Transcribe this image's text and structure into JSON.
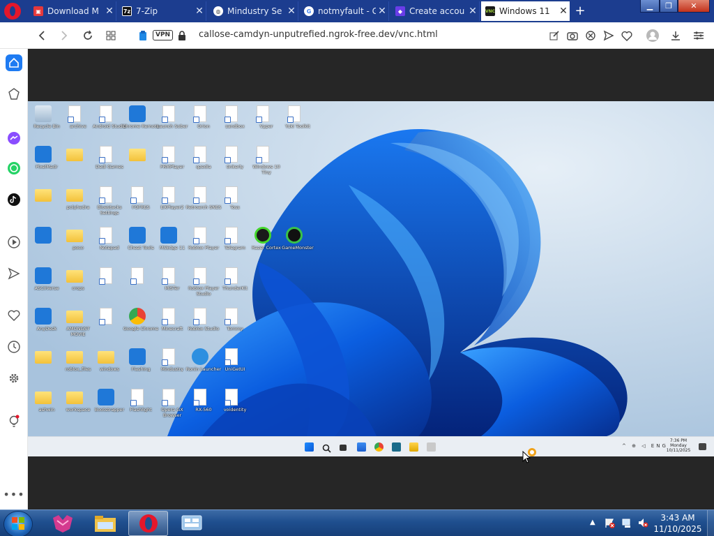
{
  "browser": {
    "tabs": [
      {
        "label": "Download M",
        "favicon": "download-icon",
        "color": "#e5383b"
      },
      {
        "label": "7-Zip",
        "favicon": "7zip-icon",
        "color": "#111111"
      },
      {
        "label": "Mindustry Se",
        "favicon": "globe-icon",
        "color": "#555555"
      },
      {
        "label": "notmyfault - G",
        "favicon": "google-icon",
        "color": "#4285f4"
      },
      {
        "label": "Create accou",
        "favicon": "app-icon",
        "color": "#6a3de8"
      },
      {
        "label": "Windows 11",
        "favicon": "vnc-icon",
        "color": "#1a1a1a"
      }
    ],
    "vpn_label": "VPN",
    "url": "callose-camdyn-unputrefied.ngrok-free.dev/vnc.html"
  },
  "vnc": {
    "desktop_icons": [
      {
        "label": "Recycle Bin",
        "kind": "recycle"
      },
      {
        "label": "PixelMadr",
        "kind": "app"
      },
      {
        "label": "",
        "kind": "folder"
      },
      {
        "label": "",
        "kind": "app"
      },
      {
        "label": "ASCIIVerse",
        "kind": "app"
      },
      {
        "label": "AnyDesk",
        "kind": "app"
      },
      {
        "label": "",
        "kind": "folder"
      },
      {
        "label": "ashwin",
        "kind": "folder"
      },
      {
        "label": "archive",
        "kind": "file"
      },
      {
        "label": "",
        "kind": "folder"
      },
      {
        "label": "polyhedra",
        "kind": "folder"
      },
      {
        "label": "poco",
        "kind": "folder"
      },
      {
        "label": "crops",
        "kind": "folder"
      },
      {
        "label": "AMONGST MOVIE",
        "kind": "folder"
      },
      {
        "label": "roblox_files",
        "kind": "folder"
      },
      {
        "label": "workspace",
        "kind": "folder"
      },
      {
        "label": "Android Studio",
        "kind": "file"
      },
      {
        "label": "Dedi Games",
        "kind": "file"
      },
      {
        "label": "Bluestacks Settings",
        "kind": "file"
      },
      {
        "label": "Notepad",
        "kind": "file"
      },
      {
        "label": "",
        "kind": "file"
      },
      {
        "label": "",
        "kind": "file"
      },
      {
        "label": "windows",
        "kind": "folder"
      },
      {
        "label": "Bootstrapper",
        "kind": "app"
      },
      {
        "label": "Chrome Remote",
        "kind": "app"
      },
      {
        "label": "",
        "kind": "folder"
      },
      {
        "label": "FOFRES",
        "kind": "file"
      },
      {
        "label": "Cheat Tools",
        "kind": "app"
      },
      {
        "label": "",
        "kind": "file"
      },
      {
        "label": "Google Chrome",
        "kind": "chrome"
      },
      {
        "label": "Flashing",
        "kind": "app"
      },
      {
        "label": "Flashlight",
        "kind": "file"
      },
      {
        "label": "Launch Sober",
        "kind": "file"
      },
      {
        "label": "FRMPlayer",
        "kind": "file"
      },
      {
        "label": "EXPlayer2",
        "kind": "file"
      },
      {
        "label": "MSEdge 11",
        "kind": "app"
      },
      {
        "label": "MiSTer",
        "kind": "file"
      },
      {
        "label": "Minecraft",
        "kind": "file"
      },
      {
        "label": "Mindustry",
        "kind": "file"
      },
      {
        "label": "Opera GX Browser",
        "kind": "file"
      },
      {
        "label": "Orion",
        "kind": "file"
      },
      {
        "label": "qzedia",
        "kind": "file"
      },
      {
        "label": "Retroarch SNES",
        "kind": "file"
      },
      {
        "label": "Roblox Player",
        "kind": "file"
      },
      {
        "label": "Roblox Player Studio",
        "kind": "file"
      },
      {
        "label": "Roblox Studio",
        "kind": "file"
      },
      {
        "label": "Ronin Launcher",
        "kind": "ie"
      },
      {
        "label": "RX-560",
        "kind": "file"
      },
      {
        "label": "sandbox",
        "kind": "file"
      },
      {
        "label": "tinkerly",
        "kind": "file"
      },
      {
        "label": "Toss",
        "kind": "file"
      },
      {
        "label": "Telegram",
        "kind": "file"
      },
      {
        "label": "ThunderKit",
        "kind": "file"
      },
      {
        "label": "Tommy",
        "kind": "file"
      },
      {
        "label": "UniGetUI",
        "kind": "file"
      },
      {
        "label": "voidentity",
        "kind": "file"
      },
      {
        "label": "Vyper",
        "kind": "file"
      },
      {
        "label": "Windows 10 Tiny",
        "kind": "file"
      },
      {
        "label": "Yuki Toolkit",
        "kind": "file"
      },
      {
        "label": "Razer Cortex",
        "kind": "razer"
      },
      {
        "label": "GameMonster",
        "kind": "gm"
      }
    ],
    "tray_lang": "ENG",
    "clock_time": "7:36 PM",
    "clock_day": "Monday",
    "clock_date": "10/11/2025"
  },
  "host": {
    "clock_time": "3:43 AM",
    "clock_date": "11/10/2025"
  },
  "colors": {
    "opera_red": "#e4172b",
    "tab_bar": "#1c3d8f",
    "vnc_bg": "#262626",
    "win11_blue": "#0a4fd6",
    "win7_taskbar": "#1f4f8f"
  }
}
